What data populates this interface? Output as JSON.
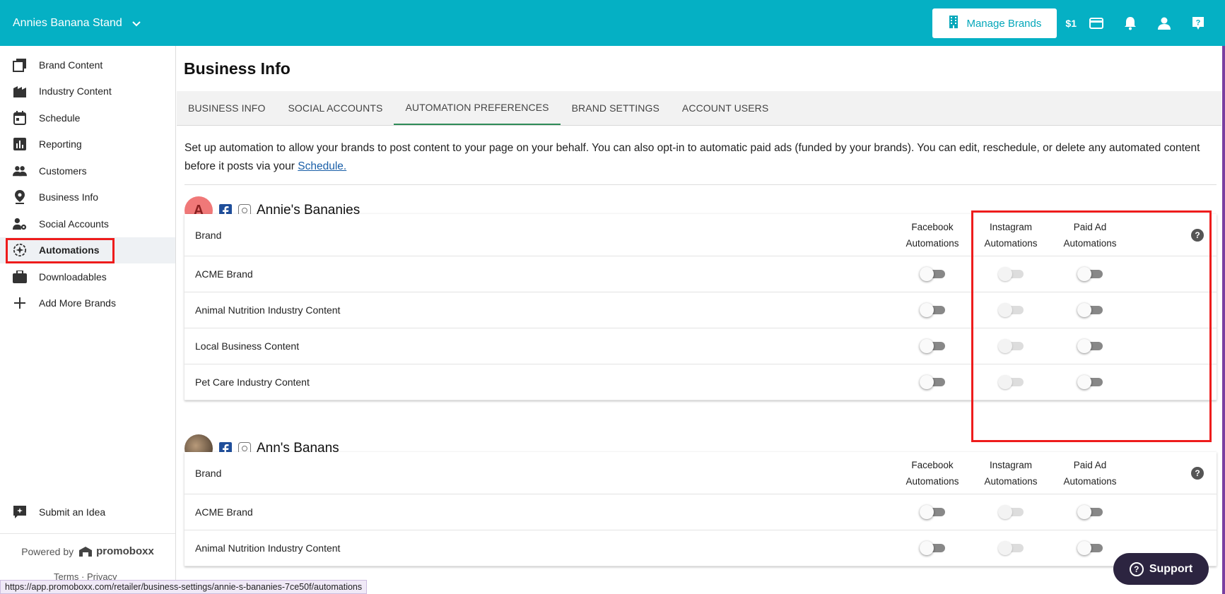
{
  "topbar": {
    "store_name": "Annies Banana Stand",
    "manage_brands_label": "Manage Brands",
    "credit": "$1"
  },
  "sidebar": {
    "items": [
      {
        "label": "Brand Content",
        "icon": "brand-content-icon"
      },
      {
        "label": "Industry Content",
        "icon": "industry-content-icon"
      },
      {
        "label": "Schedule",
        "icon": "calendar-icon"
      },
      {
        "label": "Reporting",
        "icon": "bar-chart-icon"
      },
      {
        "label": "Customers",
        "icon": "people-icon"
      },
      {
        "label": "Business Info",
        "icon": "location-pin-icon"
      },
      {
        "label": "Social Accounts",
        "icon": "person-gear-icon"
      },
      {
        "label": "Automations",
        "icon": "automation-icon",
        "active": true
      },
      {
        "label": "Downloadables",
        "icon": "briefcase-icon"
      },
      {
        "label": "Add More Brands",
        "icon": "plus-icon"
      }
    ],
    "submit_idea": "Submit an Idea",
    "powered_by": "Powered by",
    "logo_text": "promoboxx",
    "terms": "Terms · Privacy"
  },
  "main": {
    "title": "Business Info",
    "tabs": [
      {
        "label": "BUSINESS INFO"
      },
      {
        "label": "SOCIAL ACCOUNTS"
      },
      {
        "label": "AUTOMATION PREFERENCES",
        "active": true
      },
      {
        "label": "BRAND SETTINGS"
      },
      {
        "label": "ACCOUNT USERS"
      }
    ],
    "intro_text": "Set up automation to allow your brands to post content to your page on your behalf. You can also opt-in to automatic paid ads (funded by your brands). You can edit, reschedule, or delete any automated content before it posts via your ",
    "intro_link": "Schedule.",
    "columns": {
      "brand": "Brand",
      "facebook_1": "Facebook",
      "facebook_2": "Automations",
      "instagram_1": "Instagram",
      "instagram_2": "Automations",
      "paid_1": "Paid Ad",
      "paid_2": "Automations",
      "help": "?"
    },
    "pages": [
      {
        "avatar_letter": "A",
        "name": "Annie's Bananies",
        "rows": [
          {
            "brand": "ACME Brand",
            "facebook": false,
            "instagram": false,
            "instagram_disabled": true,
            "paid": false
          },
          {
            "brand": "Animal Nutrition Industry Content",
            "facebook": false,
            "instagram": false,
            "instagram_disabled": true,
            "paid": false
          },
          {
            "brand": "Local Business Content",
            "facebook": false,
            "instagram": false,
            "instagram_disabled": true,
            "paid": false
          },
          {
            "brand": "Pet Care Industry Content",
            "facebook": false,
            "instagram": false,
            "instagram_disabled": true,
            "paid": false
          }
        ]
      },
      {
        "avatar_letter": "",
        "name": "Ann's Banans",
        "rows": [
          {
            "brand": "ACME Brand",
            "facebook": false,
            "instagram": false,
            "instagram_disabled": true,
            "paid": false
          },
          {
            "brand": "Animal Nutrition Industry Content",
            "facebook": false,
            "instagram": false,
            "instagram_disabled": true,
            "paid": false
          }
        ]
      }
    ]
  },
  "support_label": "Support",
  "status_url": "https://app.promoboxx.com/retailer/business-settings/annie-s-bananies-7ce50f/automations",
  "colors": {
    "topbar": "#05b0c4",
    "highlight": "#ee1c1c",
    "tab_underline": "#2e8b57",
    "support_bg": "#2c2440"
  }
}
